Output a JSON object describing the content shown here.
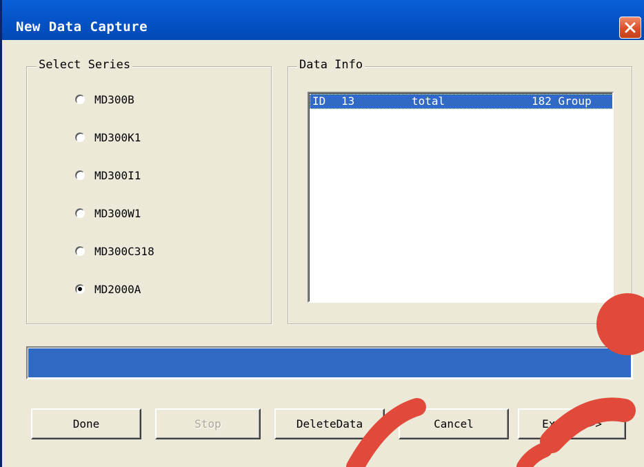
{
  "window": {
    "title": "New Data Capture",
    "close_symbol": "close-icon"
  },
  "series": {
    "label": "Select Series",
    "options": [
      "MD300B",
      "MD300K1",
      "MD300I1",
      "MD300W1",
      "MD300C318",
      "MD2000A"
    ],
    "selected": "MD2000A"
  },
  "data_info": {
    "label": "Data Info",
    "rows": [
      {
        "col1": "ID",
        "col2": "13",
        "col3": "total",
        "col4": "182 Group"
      }
    ]
  },
  "progress": {
    "percent": 100
  },
  "buttons": {
    "done": "Done",
    "stop": "Stop",
    "delete": "DeleteData",
    "cancel": "Cancel",
    "extend": "Extend >>"
  },
  "colors": {
    "accent": "#316ac5",
    "titlebar": "#0654c9",
    "close": "#d9502a",
    "face": "#ece9d8"
  }
}
